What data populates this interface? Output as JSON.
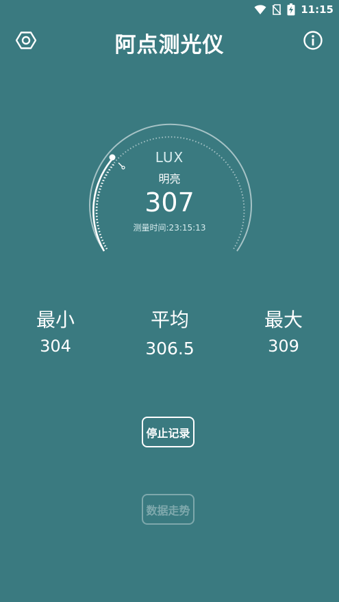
{
  "status_bar": {
    "time": "11:15"
  },
  "app_bar": {
    "title": "阿点测光仪",
    "settings_icon": "hexagon-settings-icon",
    "info_icon": "info-icon"
  },
  "gauge": {
    "unit": "LUX",
    "state": "明亮",
    "value": "307",
    "time": "测量时间:23:15:13"
  },
  "stats": {
    "min_label": "最小",
    "min_value": "304",
    "avg_label": "平均",
    "avg_value": "306.5",
    "max_label": "最大",
    "max_value": "309"
  },
  "buttons": {
    "stop_record": "停止记录",
    "data_trend": "数据走势"
  },
  "colors": {
    "background": "#3a7a80",
    "foreground": "#ffffff"
  }
}
